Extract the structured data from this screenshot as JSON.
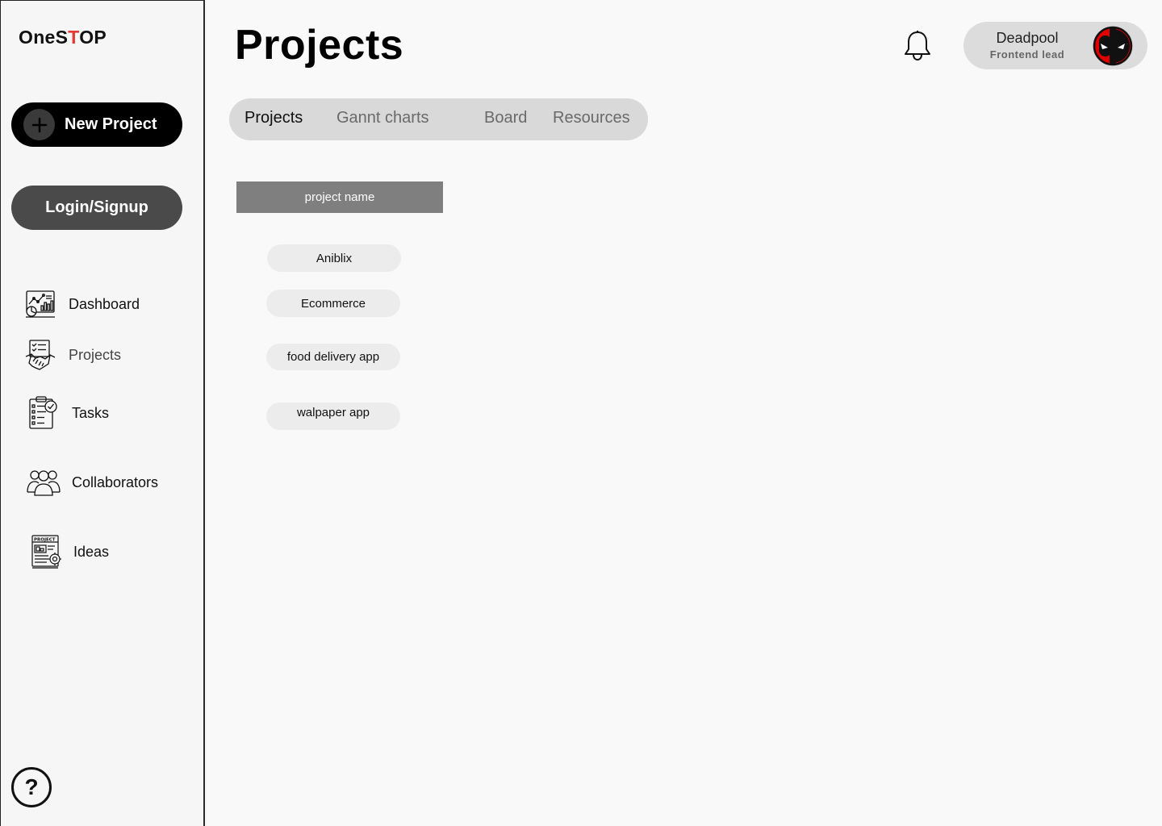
{
  "app": {
    "logo_prefix": "OneS",
    "logo_accent": "T",
    "logo_suffix": "OP",
    "accent_color": "#e53935"
  },
  "sidebar": {
    "new_project_label": "New Project",
    "login_label": "Login/Signup",
    "items": [
      {
        "label": "Dashboard",
        "icon": "dashboard-icon"
      },
      {
        "label": "Projects",
        "icon": "handshake-icon"
      },
      {
        "label": "Tasks",
        "icon": "clipboard-checklist-icon"
      },
      {
        "label": "Collaborators",
        "icon": "users-group-icon"
      },
      {
        "label": "Ideas",
        "icon": "project-ideas-icon"
      }
    ],
    "help_label": "?"
  },
  "header": {
    "title": "Projects",
    "profile": {
      "name": "Deadpool",
      "role": "Frontend lead"
    }
  },
  "tabs": [
    {
      "label": "Projects",
      "active": true
    },
    {
      "label": "Gannt charts",
      "active": false
    },
    {
      "label": "Board",
      "active": false
    },
    {
      "label": "Resources",
      "active": false
    }
  ],
  "table": {
    "column_header": "project name",
    "rows": [
      "Aniblix",
      "Ecommerce",
      "food delivery app",
      "walpaper app"
    ]
  }
}
